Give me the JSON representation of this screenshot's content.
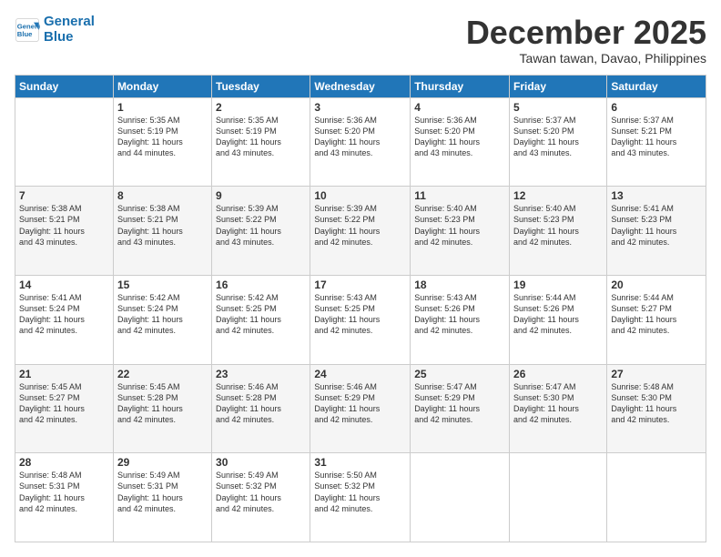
{
  "logo": {
    "line1": "General",
    "line2": "Blue"
  },
  "title": "December 2025",
  "location": "Tawan tawan, Davao, Philippines",
  "days_of_week": [
    "Sunday",
    "Monday",
    "Tuesday",
    "Wednesday",
    "Thursday",
    "Friday",
    "Saturday"
  ],
  "weeks": [
    [
      {
        "num": "",
        "info": ""
      },
      {
        "num": "1",
        "info": "Sunrise: 5:35 AM\nSunset: 5:19 PM\nDaylight: 11 hours\nand 44 minutes."
      },
      {
        "num": "2",
        "info": "Sunrise: 5:35 AM\nSunset: 5:19 PM\nDaylight: 11 hours\nand 43 minutes."
      },
      {
        "num": "3",
        "info": "Sunrise: 5:36 AM\nSunset: 5:20 PM\nDaylight: 11 hours\nand 43 minutes."
      },
      {
        "num": "4",
        "info": "Sunrise: 5:36 AM\nSunset: 5:20 PM\nDaylight: 11 hours\nand 43 minutes."
      },
      {
        "num": "5",
        "info": "Sunrise: 5:37 AM\nSunset: 5:20 PM\nDaylight: 11 hours\nand 43 minutes."
      },
      {
        "num": "6",
        "info": "Sunrise: 5:37 AM\nSunset: 5:21 PM\nDaylight: 11 hours\nand 43 minutes."
      }
    ],
    [
      {
        "num": "7",
        "info": "Sunrise: 5:38 AM\nSunset: 5:21 PM\nDaylight: 11 hours\nand 43 minutes."
      },
      {
        "num": "8",
        "info": "Sunrise: 5:38 AM\nSunset: 5:21 PM\nDaylight: 11 hours\nand 43 minutes."
      },
      {
        "num": "9",
        "info": "Sunrise: 5:39 AM\nSunset: 5:22 PM\nDaylight: 11 hours\nand 43 minutes."
      },
      {
        "num": "10",
        "info": "Sunrise: 5:39 AM\nSunset: 5:22 PM\nDaylight: 11 hours\nand 42 minutes."
      },
      {
        "num": "11",
        "info": "Sunrise: 5:40 AM\nSunset: 5:23 PM\nDaylight: 11 hours\nand 42 minutes."
      },
      {
        "num": "12",
        "info": "Sunrise: 5:40 AM\nSunset: 5:23 PM\nDaylight: 11 hours\nand 42 minutes."
      },
      {
        "num": "13",
        "info": "Sunrise: 5:41 AM\nSunset: 5:23 PM\nDaylight: 11 hours\nand 42 minutes."
      }
    ],
    [
      {
        "num": "14",
        "info": "Sunrise: 5:41 AM\nSunset: 5:24 PM\nDaylight: 11 hours\nand 42 minutes."
      },
      {
        "num": "15",
        "info": "Sunrise: 5:42 AM\nSunset: 5:24 PM\nDaylight: 11 hours\nand 42 minutes."
      },
      {
        "num": "16",
        "info": "Sunrise: 5:42 AM\nSunset: 5:25 PM\nDaylight: 11 hours\nand 42 minutes."
      },
      {
        "num": "17",
        "info": "Sunrise: 5:43 AM\nSunset: 5:25 PM\nDaylight: 11 hours\nand 42 minutes."
      },
      {
        "num": "18",
        "info": "Sunrise: 5:43 AM\nSunset: 5:26 PM\nDaylight: 11 hours\nand 42 minutes."
      },
      {
        "num": "19",
        "info": "Sunrise: 5:44 AM\nSunset: 5:26 PM\nDaylight: 11 hours\nand 42 minutes."
      },
      {
        "num": "20",
        "info": "Sunrise: 5:44 AM\nSunset: 5:27 PM\nDaylight: 11 hours\nand 42 minutes."
      }
    ],
    [
      {
        "num": "21",
        "info": "Sunrise: 5:45 AM\nSunset: 5:27 PM\nDaylight: 11 hours\nand 42 minutes."
      },
      {
        "num": "22",
        "info": "Sunrise: 5:45 AM\nSunset: 5:28 PM\nDaylight: 11 hours\nand 42 minutes."
      },
      {
        "num": "23",
        "info": "Sunrise: 5:46 AM\nSunset: 5:28 PM\nDaylight: 11 hours\nand 42 minutes."
      },
      {
        "num": "24",
        "info": "Sunrise: 5:46 AM\nSunset: 5:29 PM\nDaylight: 11 hours\nand 42 minutes."
      },
      {
        "num": "25",
        "info": "Sunrise: 5:47 AM\nSunset: 5:29 PM\nDaylight: 11 hours\nand 42 minutes."
      },
      {
        "num": "26",
        "info": "Sunrise: 5:47 AM\nSunset: 5:30 PM\nDaylight: 11 hours\nand 42 minutes."
      },
      {
        "num": "27",
        "info": "Sunrise: 5:48 AM\nSunset: 5:30 PM\nDaylight: 11 hours\nand 42 minutes."
      }
    ],
    [
      {
        "num": "28",
        "info": "Sunrise: 5:48 AM\nSunset: 5:31 PM\nDaylight: 11 hours\nand 42 minutes."
      },
      {
        "num": "29",
        "info": "Sunrise: 5:49 AM\nSunset: 5:31 PM\nDaylight: 11 hours\nand 42 minutes."
      },
      {
        "num": "30",
        "info": "Sunrise: 5:49 AM\nSunset: 5:32 PM\nDaylight: 11 hours\nand 42 minutes."
      },
      {
        "num": "31",
        "info": "Sunrise: 5:50 AM\nSunset: 5:32 PM\nDaylight: 11 hours\nand 42 minutes."
      },
      {
        "num": "",
        "info": ""
      },
      {
        "num": "",
        "info": ""
      },
      {
        "num": "",
        "info": ""
      }
    ]
  ]
}
